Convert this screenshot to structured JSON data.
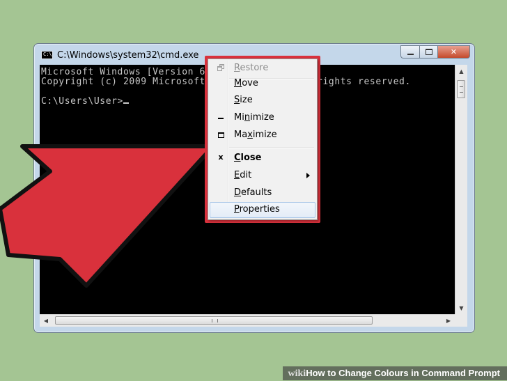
{
  "window": {
    "title": "C:\\Windows\\system32\\cmd.exe",
    "icon": "cmd-app-icon",
    "buttons": {
      "minimize": "minimize-icon",
      "maximize": "maximize-icon",
      "close": "close-icon"
    }
  },
  "console": {
    "lines": [
      "Microsoft Windows [Version 6.1.7601]",
      "Copyright (c) 2009 Microsoft Corporation.  All rights reserved.",
      "",
      "C:\\Users\\User>"
    ]
  },
  "menu": {
    "items": [
      {
        "label": "Restore",
        "mnemonic": "R",
        "rest": "estore",
        "disabled": true,
        "icon": "restore-icon"
      },
      {
        "label": "Move",
        "mnemonic": "M",
        "rest": "ove"
      },
      {
        "label": "Size",
        "mnemonic": "S",
        "rest": "ize"
      },
      {
        "label": "Minimize",
        "mnemonic": "n",
        "pre": "Mi",
        "rest": "imize",
        "icon": "minimize-icon"
      },
      {
        "label": "Maximize",
        "mnemonic": "x",
        "pre": "Ma",
        "rest": "imize",
        "icon": "maximize-icon"
      },
      {
        "label": "Close",
        "mnemonic": "C",
        "rest": "lose",
        "bold": true,
        "icon": "close-icon"
      },
      {
        "label": "Edit",
        "mnemonic": "E",
        "rest": "dit",
        "submenu": true
      },
      {
        "label": "Defaults",
        "mnemonic": "D",
        "rest": "efaults"
      },
      {
        "label": "Properties",
        "mnemonic": "P",
        "rest": "roperties",
        "highlighted": true
      }
    ]
  },
  "watermark": {
    "brand": "wiki",
    "brand_bold": "How",
    "text": " to Change Colours in Command Prompt"
  },
  "colors": {
    "background": "#a4c593",
    "arrow": "#d9313c",
    "console_bg": "#000000",
    "console_text": "#c8c8c8"
  }
}
